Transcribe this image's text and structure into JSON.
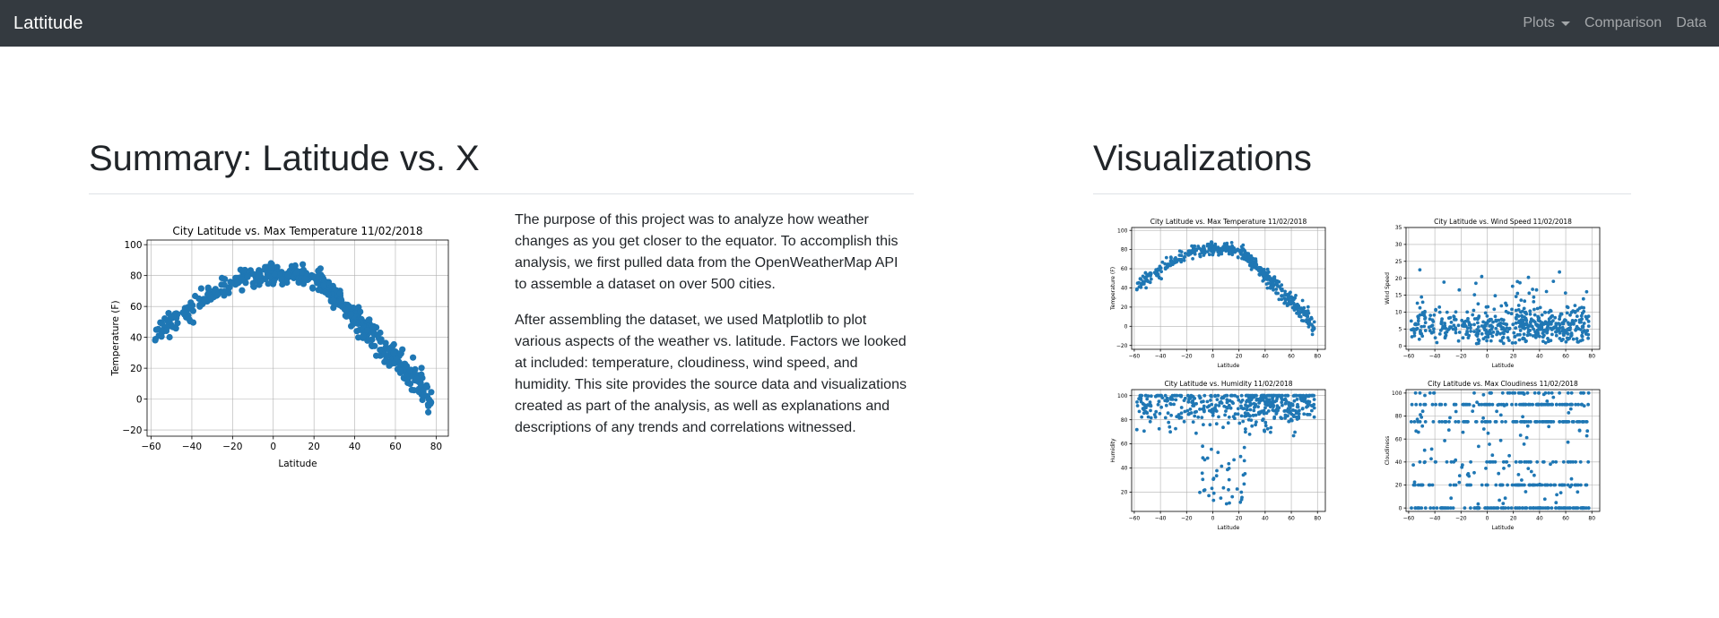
{
  "navbar": {
    "brand": "Lattitude",
    "links": [
      "Plots",
      "Comparison",
      "Data"
    ]
  },
  "summary": {
    "title": "Summary: Latitude vs. X",
    "paragraph1": "The purpose of this project was to analyze how weather changes as you get closer to the equator. To accomplish this analysis, we first pulled data from the OpenWeatherMap API to assemble a dataset on over 500 cities.",
    "paragraph2": "After assembling the dataset, we used Matplotlib to plot various aspects of the weather vs. latitude. Factors we looked at included: temperature, cloudiness, wind speed, and humidity. This site provides the source data and visualizations created as part of the analysis, as well as explanations and descriptions of any trends and correlations witnessed."
  },
  "visualizations": {
    "title": "Visualizations"
  },
  "colors": {
    "navbar_bg": "#343a40",
    "point": "#1f77b4"
  },
  "chart_data": [
    {
      "id": "summary-temp",
      "type": "scatter",
      "title": "City Latitude vs. Max Temperature 11/02/2018",
      "xlabel": "Latitude",
      "ylabel": "Temperature (F)",
      "xlim": [
        -62,
        86
      ],
      "ylim": [
        -24,
        103
      ],
      "xticks": [
        -60,
        -40,
        -20,
        0,
        20,
        40,
        60,
        80
      ],
      "yticks": [
        -20,
        0,
        20,
        40,
        60,
        80,
        100
      ],
      "grid": true,
      "trend": "temperature peaks (~75-95F) between -20 and 20 latitude, falls to ~45-60F near -45 and to ~-10-20F near 65-75",
      "x": [
        -60,
        -55,
        -48,
        -45,
        -42,
        -40,
        -38,
        -35,
        -30,
        -25,
        -20,
        -15,
        -12,
        -10,
        -5,
        0,
        5,
        10,
        15,
        20,
        25,
        30,
        35,
        40,
        45,
        50,
        55,
        60,
        65,
        70,
        75
      ],
      "y": [
        48,
        58,
        62,
        50,
        45,
        55,
        65,
        72,
        75,
        80,
        85,
        82,
        88,
        80,
        84,
        82,
        85,
        84,
        80,
        78,
        72,
        70,
        62,
        55,
        48,
        40,
        30,
        22,
        12,
        5,
        15
      ]
    },
    {
      "id": "viz-temp",
      "type": "scatter",
      "title": "City Latitude vs. Max Temperature 11/02/2018",
      "xlabel": "Latitude",
      "ylabel": "Temperature (F)",
      "xlim": [
        -62,
        86
      ],
      "ylim": [
        -24,
        103
      ],
      "xticks": [
        -60,
        -40,
        -20,
        0,
        20,
        40,
        60,
        80
      ],
      "yticks": [
        -20,
        0,
        20,
        40,
        60,
        80,
        100
      ],
      "grid": true,
      "trend": "same data as summary temperature plot"
    },
    {
      "id": "viz-wind",
      "type": "scatter",
      "title": "City Latitude vs. Wind Speed 11/02/2018",
      "xlabel": "Latitude",
      "ylabel": "Wind Speed",
      "xlim": [
        -62,
        86
      ],
      "ylim": [
        -1,
        35
      ],
      "xticks": [
        -60,
        -40,
        -20,
        0,
        20,
        40,
        60,
        80
      ],
      "yticks": [
        0,
        5,
        10,
        15,
        20,
        25,
        30,
        35
      ],
      "grid": true,
      "trend": "mostly 0-15, scattered up to ~33 across all latitudes"
    },
    {
      "id": "viz-humidity",
      "type": "scatter",
      "title": "City Latitude vs. Humidity 11/02/2018",
      "xlabel": "Latitude",
      "ylabel": "Humidity",
      "xlim": [
        -62,
        86
      ],
      "ylim": [
        4,
        105
      ],
      "xticks": [
        -60,
        -40,
        -20,
        0,
        20,
        40,
        60,
        80
      ],
      "yticks": [
        20,
        40,
        60,
        80,
        100
      ],
      "grid": true,
      "trend": "mostly 60-100, spread down to ~10 around latitude 0-20"
    },
    {
      "id": "viz-cloud",
      "type": "scatter",
      "title": "City Latitude vs. Max Cloudiness 11/02/2018",
      "xlabel": "Latitude",
      "ylabel": "Cloudiness",
      "xlim": [
        -62,
        86
      ],
      "ylim": [
        -3,
        103
      ],
      "xticks": [
        -60,
        -40,
        -20,
        0,
        20,
        40,
        60,
        80
      ],
      "yticks": [
        0,
        20,
        40,
        60,
        80,
        100
      ],
      "grid": true,
      "trend": "banded at 0, 20, 40, 75, 90 across latitudes"
    }
  ]
}
